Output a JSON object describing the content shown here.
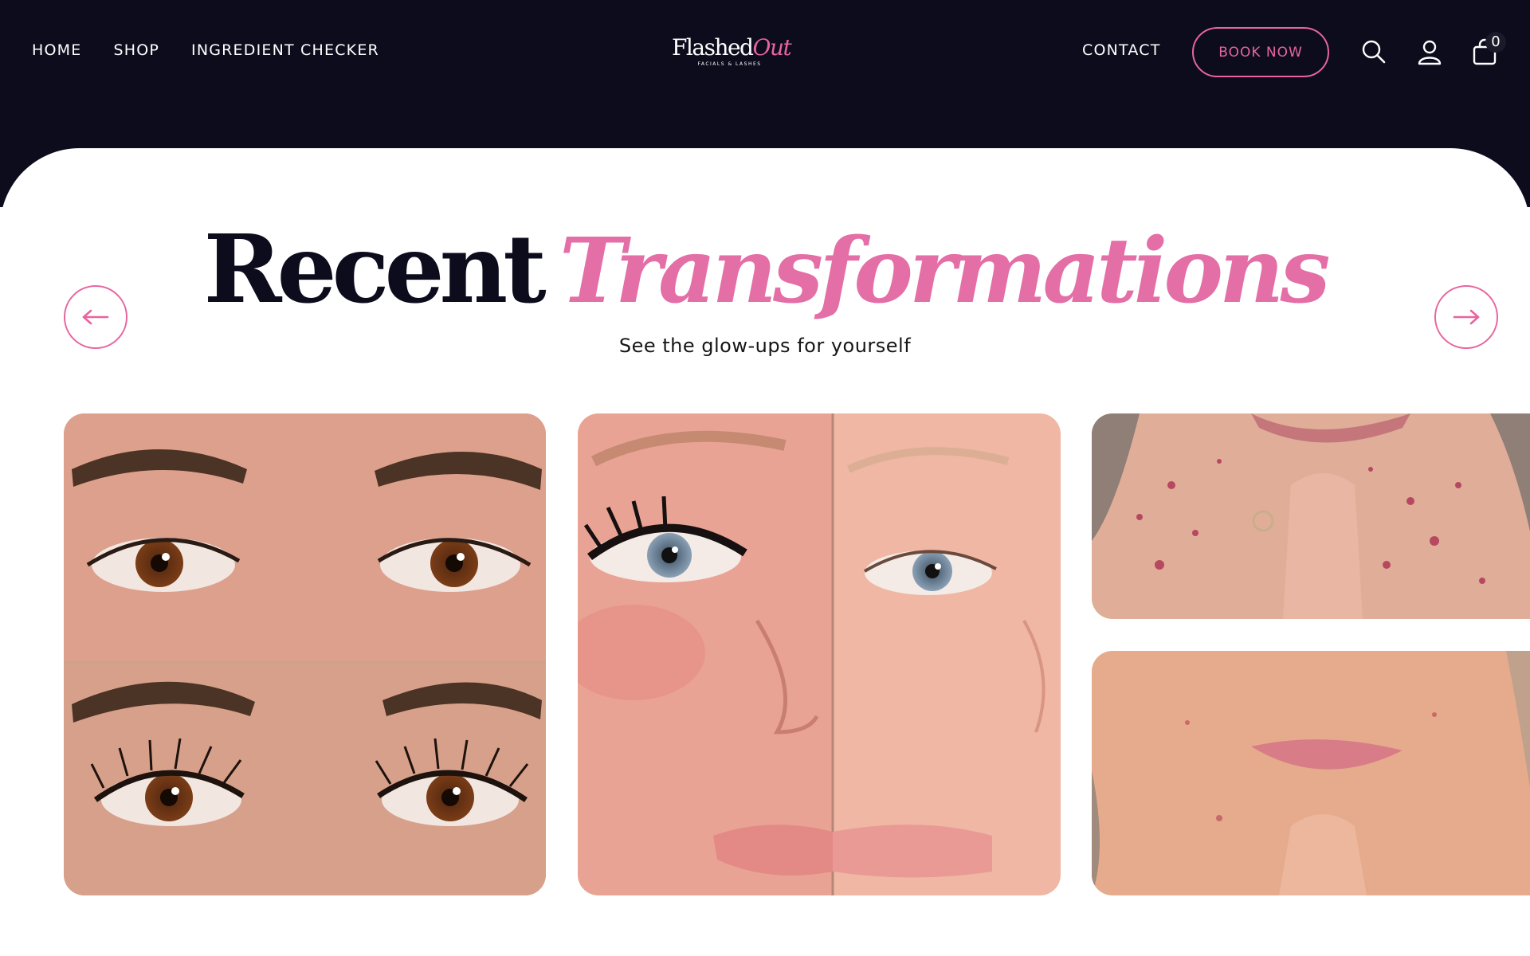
{
  "nav": {
    "home": "HOME",
    "shop": "SHOP",
    "ingredient_checker": "INGREDIENT CHECKER",
    "contact": "CONTACT",
    "book_now": "BOOK NOW"
  },
  "logo": {
    "main": "Flashed",
    "accent": "Out",
    "sub": "FACIALS & LASHES"
  },
  "icons": {
    "search": "search-icon",
    "account": "user-icon",
    "cart": "bag-icon"
  },
  "cart": {
    "count": "0"
  },
  "section": {
    "title_part1": "Recent",
    "title_part2": "Transformations",
    "subtitle": "See the glow-ups for yourself"
  },
  "carousel": {
    "prev_icon": "arrow-left-icon",
    "next_icon": "arrow-right-icon",
    "images": [
      "before-after-lash-lift-eyes",
      "before-after-lash-extension-face",
      "before-after-facial-chin-top",
      "before-after-facial-chin-bottom"
    ]
  },
  "colors": {
    "navy": "#0c0c1d",
    "pink": "#e8659f",
    "white": "#ffffff"
  }
}
